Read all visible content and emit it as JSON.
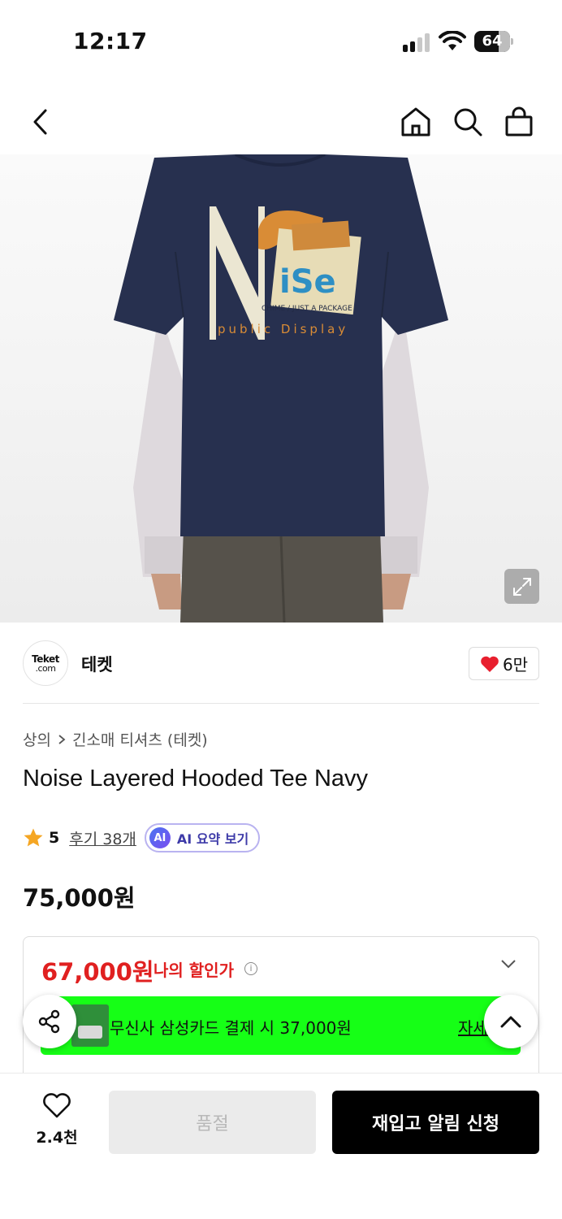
{
  "status_bar": {
    "time": "12:17",
    "battery": "64"
  },
  "nav": {
    "back": "back-icon",
    "home": "home-icon",
    "search": "search-icon",
    "cart": "bag-icon"
  },
  "product_image": {
    "print_big_letter": "N",
    "print_word": "iSe",
    "print_line": "CHIME / JUST A PACKAGE",
    "print_subtitle": "public Display"
  },
  "brand": {
    "logo_line1": "Teket",
    "logo_line2": ".com",
    "name": "테켓",
    "likes": "6만"
  },
  "breadcrumb": {
    "category": "상의",
    "subcategory": "긴소매 티셔츠 (테켓)"
  },
  "product": {
    "title": "Noise Layered Hooded Tee Navy",
    "rating": "5",
    "reviews": "후기 38개",
    "ai_badge": "AI",
    "ai_summary": "AI 요약 보기",
    "price": "75,000원"
  },
  "discount": {
    "price": "67,000원",
    "label": "나의 할인가",
    "info": "i",
    "card_offer": "무신사 삼성카드 결제 시 37,000원",
    "card_more": "자세히"
  },
  "bottom_bar": {
    "wish_count": "2.4천",
    "soldout_label": "품절",
    "restock_label": "재입고 알림 신청"
  },
  "colors": {
    "accent_red": "#e02020",
    "banner_green": "#16ff16",
    "shirt_navy": "#27304f"
  }
}
